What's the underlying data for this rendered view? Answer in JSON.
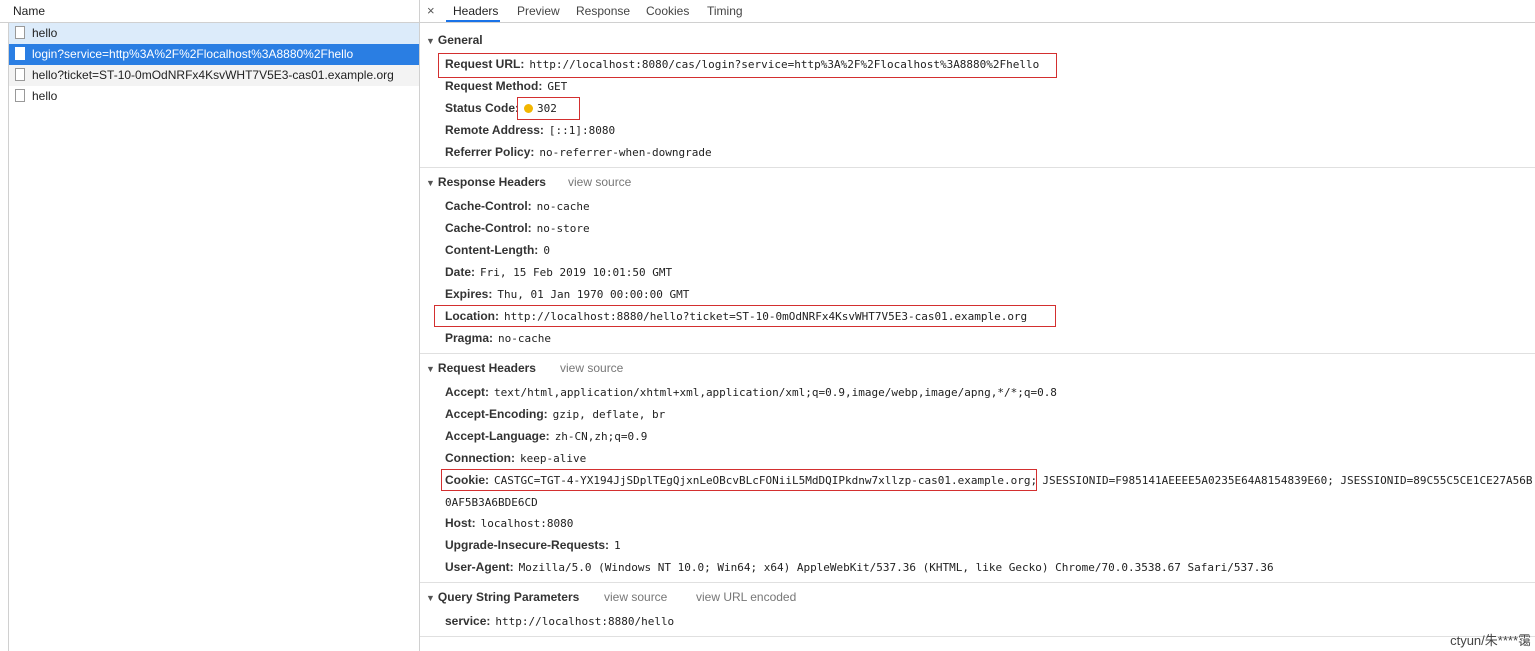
{
  "left": {
    "header": "Name",
    "requests": [
      {
        "name": "hello",
        "state": "hover"
      },
      {
        "name": "login?service=http%3A%2F%2Flocalhost%3A8880%2Fhello",
        "state": "selected"
      },
      {
        "name": "hello?ticket=ST-10-0mOdNRFx4KsvWHT7V5E3-cas01.example.org",
        "state": "alt"
      },
      {
        "name": "hello",
        "state": "normal"
      }
    ]
  },
  "tabs": [
    "Headers",
    "Preview",
    "Response",
    "Cookies",
    "Timing"
  ],
  "active_tab": "Headers",
  "close_symbol": "×",
  "general": {
    "title": "General",
    "request_url_label": "Request URL:",
    "request_url": "http://localhost:8080/cas/login?service=http%3A%2F%2Flocalhost%3A8880%2Fhello",
    "method_label": "Request Method:",
    "method": "GET",
    "status_label": "Status Code:",
    "status": "302",
    "remote_label": "Remote Address:",
    "remote": "[::1]:8080",
    "referrer_label": "Referrer Policy:",
    "referrer": "no-referrer-when-downgrade"
  },
  "response_headers": {
    "title": "Response Headers",
    "view_source": "view source",
    "items": [
      {
        "k": "Cache-Control:",
        "v": "no-cache"
      },
      {
        "k": "Cache-Control:",
        "v": "no-store"
      },
      {
        "k": "Content-Length:",
        "v": "0"
      },
      {
        "k": "Date:",
        "v": "Fri, 15 Feb 2019 10:01:50 GMT"
      },
      {
        "k": "Expires:",
        "v": "Thu, 01 Jan 1970 00:00:00 GMT"
      },
      {
        "k": "Location:",
        "v": "http://localhost:8880/hello?ticket=ST-10-0mOdNRFx4KsvWHT7V5E3-cas01.example.org"
      },
      {
        "k": "Pragma:",
        "v": "no-cache"
      }
    ]
  },
  "request_headers": {
    "title": "Request Headers",
    "view_source": "view source",
    "accept_k": "Accept:",
    "accept_v": "text/html,application/xhtml+xml,application/xml;q=0.9,image/webp,image/apng,*/*;q=0.8",
    "encoding_k": "Accept-Encoding:",
    "encoding_v": "gzip, deflate, br",
    "language_k": "Accept-Language:",
    "language_v": "zh-CN,zh;q=0.9",
    "connection_k": "Connection:",
    "connection_v": "keep-alive",
    "cookie_k": "Cookie:",
    "cookie_v1": "CASTGC=TGT-4-YX194JjSDplTEgQjxnLeOBcvBLcFONiiL5MdDQIPkdnw7xllzp-cas01.example.org;",
    "cookie_v2": "JSESSIONID=F985141AEEEE5A0235E64A8154839E60; JSESSIONID=89C55C5CE1CE27A56B",
    "cookie_v3": "0AF5B3A6BDE6CD",
    "host_k": "Host:",
    "host_v": "localhost:8080",
    "upgrade_k": "Upgrade-Insecure-Requests:",
    "upgrade_v": "1",
    "ua_k": "User-Agent:",
    "ua_v": "Mozilla/5.0 (Windows NT 10.0; Win64; x64) AppleWebKit/537.36 (KHTML, like Gecko) Chrome/70.0.3538.67 Safari/537.36"
  },
  "query_params": {
    "title": "Query String Parameters",
    "view_source": "view source",
    "view_encoded": "view URL encoded",
    "service_k": "service:",
    "service_v": "http://localhost:8880/hello"
  },
  "watermark": "ctyun/朱****霭"
}
